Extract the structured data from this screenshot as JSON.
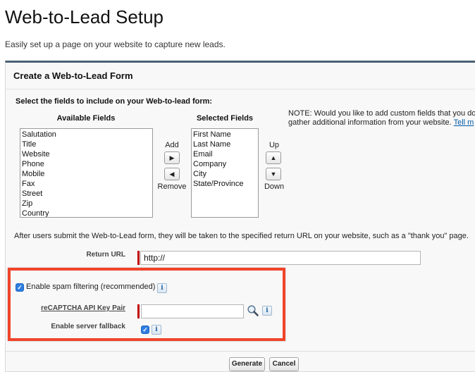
{
  "page": {
    "title": "Web-to-Lead Setup",
    "subtitle": "Easily set up a page on your website to capture new leads."
  },
  "panel": {
    "title": "Create a Web-to-Lead Form",
    "section_label": "Select the fields to include on your Web-to-lead form:",
    "available": {
      "heading": "Available Fields",
      "items": [
        "Salutation",
        "Title",
        "Website",
        "Phone",
        "Mobile",
        "Fax",
        "Street",
        "Zip",
        "Country"
      ]
    },
    "selected": {
      "heading": "Selected Fields",
      "items": [
        "First Name",
        "Last Name",
        "Email",
        "Company",
        "City",
        "State/Province"
      ]
    },
    "add_label": "Add",
    "remove_label": "Remove",
    "up_label": "Up",
    "down_label": "Down",
    "note_line1": "NOTE: Would you like to add custom fields that you do",
    "note_line2": "gather additional information from your website.",
    "note_link": "Tell m",
    "return_info": "After users submit the Web-to-Lead form, they will be taken to the specified return URL on your website, such as a \"thank you\" page.",
    "return_url_label": "Return URL",
    "return_url_value": "http://",
    "spam_label": "Enable spam filtering (recommended)",
    "recaptcha_label": "reCAPTCHA API Key Pair",
    "recaptcha_value": "",
    "fallback_label": "Enable server fallback",
    "generate_label": "Generate",
    "cancel_label": "Cancel"
  },
  "icons": {
    "add": "right-arrow",
    "remove": "left-arrow",
    "up": "up-arrow",
    "down": "down-arrow",
    "lookup": "magnifier",
    "info": "info"
  },
  "colors": {
    "accent_border": "#4a6172",
    "required": "#c00000",
    "highlight": "#f0442a",
    "checkbox": "#2f7de1"
  }
}
